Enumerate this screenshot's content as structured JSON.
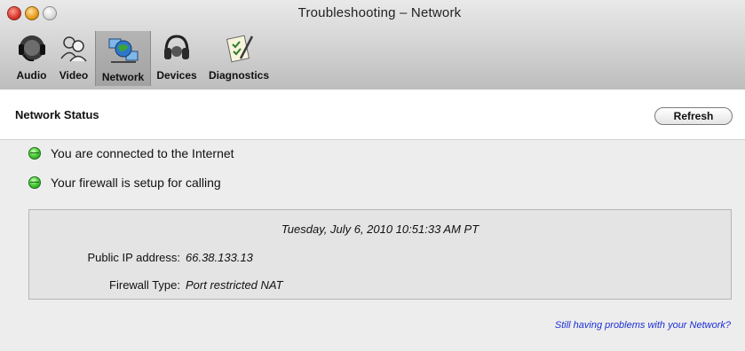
{
  "window": {
    "title": "Troubleshooting – Network"
  },
  "toolbar": {
    "items": [
      {
        "label": "Audio",
        "icon": "headset-mic-icon"
      },
      {
        "label": "Video",
        "icon": "video-people-icon"
      },
      {
        "label": "Network",
        "icon": "network-globe-icon",
        "selected": true
      },
      {
        "label": "Devices",
        "icon": "headphones-icon"
      },
      {
        "label": "Diagnostics",
        "icon": "diagnostics-checklist-icon"
      }
    ]
  },
  "section": {
    "title": "Network Status",
    "refresh_label": "Refresh"
  },
  "status": {
    "lines": [
      {
        "text": "You are connected to the Internet",
        "state": "ok",
        "color": "#3fcc2f"
      },
      {
        "text": "Your firewall is setup for calling",
        "state": "ok",
        "color": "#3fcc2f"
      }
    ]
  },
  "info": {
    "timestamp": "Tuesday, July 6, 2010 10:51:33 AM PT",
    "public_ip_label": "Public IP address:",
    "public_ip_value": "66.38.133.13",
    "firewall_type_label": "Firewall Type:",
    "firewall_type_value": "Port restricted NAT"
  },
  "help_link": "Still having problems with your Network?",
  "colors": {
    "link": "#1c2fd6",
    "selected_tab": "#a8a8a8"
  }
}
